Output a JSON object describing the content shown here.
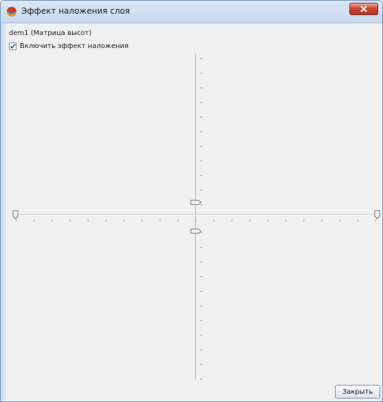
{
  "window": {
    "title": "Эффект наложения слоя"
  },
  "layer": {
    "name": "dem1 (Матрица высот)"
  },
  "overlay_checkbox": {
    "label": "Включить эффект наложения",
    "checked": true
  },
  "sliders": {
    "vertical_top": {
      "value": 0
    },
    "vertical_bottom": {
      "value": 0
    },
    "horizontal_left": {
      "value": 0
    },
    "horizontal_right": {
      "value": 1
    }
  },
  "buttons": {
    "close_label": "Закрыть"
  },
  "colors": {
    "accent": "#c94530",
    "titlebar": "#dbe7f6",
    "client": "#f0f0f0",
    "tick": "#9a9a9a"
  },
  "icons": {
    "app": "app-logo-icon",
    "close": "close-icon",
    "check": "checkmark-icon"
  }
}
